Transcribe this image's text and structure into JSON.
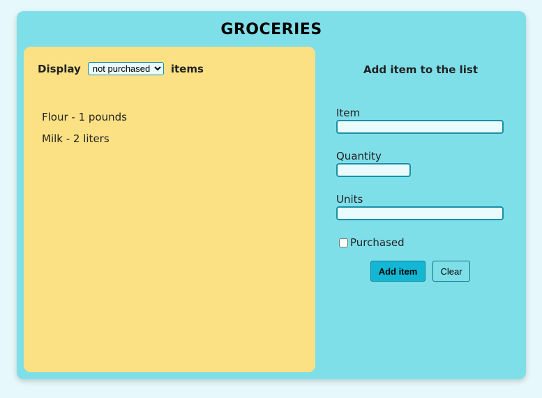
{
  "app": {
    "title": "GROCERIES"
  },
  "list_panel": {
    "display_label": "Display",
    "filter_value": "not purchased",
    "filter_options": [
      "not purchased"
    ],
    "items_label": "items",
    "items": [
      {
        "text": "Flour - 1 pounds"
      },
      {
        "text": "Milk - 2 liters"
      }
    ]
  },
  "form": {
    "heading": "Add item to the list",
    "item_label": "Item",
    "item_value": "",
    "quantity_label": "Quantity",
    "quantity_value": "",
    "units_label": "Units",
    "units_value": "",
    "purchased_label": "Purchased",
    "purchased_checked": false,
    "add_button": "Add item",
    "clear_button": "Clear"
  },
  "colors": {
    "page_bg": "#e6f8fb",
    "app_bg": "#7fdfe9",
    "list_bg": "#fbe184",
    "accent": "#13b7d3",
    "input_border": "#1a8fa6"
  }
}
